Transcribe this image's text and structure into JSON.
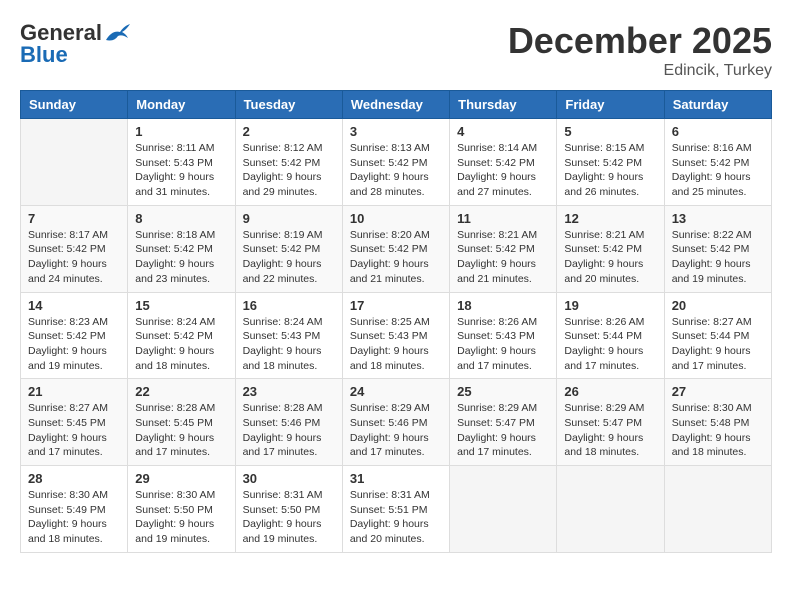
{
  "logo": {
    "general": "General",
    "blue": "Blue"
  },
  "title": "December 2025",
  "location": "Edincik, Turkey",
  "headers": [
    "Sunday",
    "Monday",
    "Tuesday",
    "Wednesday",
    "Thursday",
    "Friday",
    "Saturday"
  ],
  "weeks": [
    [
      {
        "day": "",
        "info": ""
      },
      {
        "day": "1",
        "info": "Sunrise: 8:11 AM\nSunset: 5:43 PM\nDaylight: 9 hours\nand 31 minutes."
      },
      {
        "day": "2",
        "info": "Sunrise: 8:12 AM\nSunset: 5:42 PM\nDaylight: 9 hours\nand 29 minutes."
      },
      {
        "day": "3",
        "info": "Sunrise: 8:13 AM\nSunset: 5:42 PM\nDaylight: 9 hours\nand 28 minutes."
      },
      {
        "day": "4",
        "info": "Sunrise: 8:14 AM\nSunset: 5:42 PM\nDaylight: 9 hours\nand 27 minutes."
      },
      {
        "day": "5",
        "info": "Sunrise: 8:15 AM\nSunset: 5:42 PM\nDaylight: 9 hours\nand 26 minutes."
      },
      {
        "day": "6",
        "info": "Sunrise: 8:16 AM\nSunset: 5:42 PM\nDaylight: 9 hours\nand 25 minutes."
      }
    ],
    [
      {
        "day": "7",
        "info": "Sunrise: 8:17 AM\nSunset: 5:42 PM\nDaylight: 9 hours\nand 24 minutes."
      },
      {
        "day": "8",
        "info": "Sunrise: 8:18 AM\nSunset: 5:42 PM\nDaylight: 9 hours\nand 23 minutes."
      },
      {
        "day": "9",
        "info": "Sunrise: 8:19 AM\nSunset: 5:42 PM\nDaylight: 9 hours\nand 22 minutes."
      },
      {
        "day": "10",
        "info": "Sunrise: 8:20 AM\nSunset: 5:42 PM\nDaylight: 9 hours\nand 21 minutes."
      },
      {
        "day": "11",
        "info": "Sunrise: 8:21 AM\nSunset: 5:42 PM\nDaylight: 9 hours\nand 21 minutes."
      },
      {
        "day": "12",
        "info": "Sunrise: 8:21 AM\nSunset: 5:42 PM\nDaylight: 9 hours\nand 20 minutes."
      },
      {
        "day": "13",
        "info": "Sunrise: 8:22 AM\nSunset: 5:42 PM\nDaylight: 9 hours\nand 19 minutes."
      }
    ],
    [
      {
        "day": "14",
        "info": "Sunrise: 8:23 AM\nSunset: 5:42 PM\nDaylight: 9 hours\nand 19 minutes."
      },
      {
        "day": "15",
        "info": "Sunrise: 8:24 AM\nSunset: 5:42 PM\nDaylight: 9 hours\nand 18 minutes."
      },
      {
        "day": "16",
        "info": "Sunrise: 8:24 AM\nSunset: 5:43 PM\nDaylight: 9 hours\nand 18 minutes."
      },
      {
        "day": "17",
        "info": "Sunrise: 8:25 AM\nSunset: 5:43 PM\nDaylight: 9 hours\nand 18 minutes."
      },
      {
        "day": "18",
        "info": "Sunrise: 8:26 AM\nSunset: 5:43 PM\nDaylight: 9 hours\nand 17 minutes."
      },
      {
        "day": "19",
        "info": "Sunrise: 8:26 AM\nSunset: 5:44 PM\nDaylight: 9 hours\nand 17 minutes."
      },
      {
        "day": "20",
        "info": "Sunrise: 8:27 AM\nSunset: 5:44 PM\nDaylight: 9 hours\nand 17 minutes."
      }
    ],
    [
      {
        "day": "21",
        "info": "Sunrise: 8:27 AM\nSunset: 5:45 PM\nDaylight: 9 hours\nand 17 minutes."
      },
      {
        "day": "22",
        "info": "Sunrise: 8:28 AM\nSunset: 5:45 PM\nDaylight: 9 hours\nand 17 minutes."
      },
      {
        "day": "23",
        "info": "Sunrise: 8:28 AM\nSunset: 5:46 PM\nDaylight: 9 hours\nand 17 minutes."
      },
      {
        "day": "24",
        "info": "Sunrise: 8:29 AM\nSunset: 5:46 PM\nDaylight: 9 hours\nand 17 minutes."
      },
      {
        "day": "25",
        "info": "Sunrise: 8:29 AM\nSunset: 5:47 PM\nDaylight: 9 hours\nand 17 minutes."
      },
      {
        "day": "26",
        "info": "Sunrise: 8:29 AM\nSunset: 5:47 PM\nDaylight: 9 hours\nand 18 minutes."
      },
      {
        "day": "27",
        "info": "Sunrise: 8:30 AM\nSunset: 5:48 PM\nDaylight: 9 hours\nand 18 minutes."
      }
    ],
    [
      {
        "day": "28",
        "info": "Sunrise: 8:30 AM\nSunset: 5:49 PM\nDaylight: 9 hours\nand 18 minutes."
      },
      {
        "day": "29",
        "info": "Sunrise: 8:30 AM\nSunset: 5:50 PM\nDaylight: 9 hours\nand 19 minutes."
      },
      {
        "day": "30",
        "info": "Sunrise: 8:31 AM\nSunset: 5:50 PM\nDaylight: 9 hours\nand 19 minutes."
      },
      {
        "day": "31",
        "info": "Sunrise: 8:31 AM\nSunset: 5:51 PM\nDaylight: 9 hours\nand 20 minutes."
      },
      {
        "day": "",
        "info": ""
      },
      {
        "day": "",
        "info": ""
      },
      {
        "day": "",
        "info": ""
      }
    ]
  ]
}
